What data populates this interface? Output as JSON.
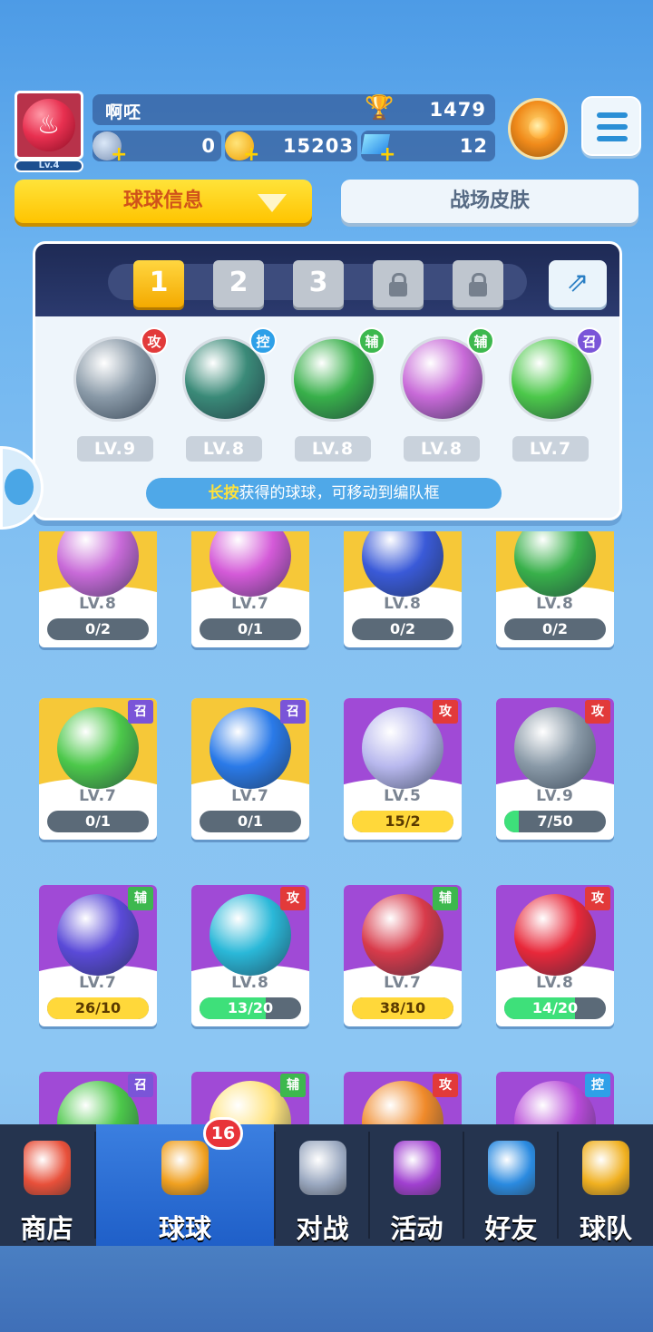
{
  "player": {
    "name": "啊呸",
    "level": "Lv.4",
    "trophies": "1479",
    "energy": "0",
    "coins": "15203",
    "gems": "12"
  },
  "tabs": {
    "ball_info": "球球信息",
    "skins": "战场皮肤"
  },
  "team": {
    "slots": [
      "1",
      "2",
      "3"
    ],
    "balls": [
      {
        "tag": "攻",
        "tag_type": "atk",
        "level": "LV.9",
        "color": "#8a9aa8"
      },
      {
        "tag": "控",
        "tag_type": "ctl",
        "level": "LV.8",
        "color": "#3a8a78"
      },
      {
        "tag": "辅",
        "tag_type": "sup",
        "level": "LV.8",
        "color": "#38b04a"
      },
      {
        "tag": "辅",
        "tag_type": "sup",
        "level": "LV.8",
        "color": "#c86ad8"
      },
      {
        "tag": "召",
        "tag_type": "sum",
        "level": "LV.7",
        "color": "#4cc84a"
      }
    ],
    "hint_highlight": "长按",
    "hint_rest": "获得的球球，可移动到编队框"
  },
  "cards": [
    {
      "bg": "yellow",
      "tag": "",
      "tag_type": "",
      "level": "LV.8",
      "progress": "0/2",
      "fill": 0,
      "fill_color": "#ffd83a",
      "color": "#c86ad8"
    },
    {
      "bg": "yellow",
      "tag": "",
      "tag_type": "",
      "level": "LV.7",
      "progress": "0/1",
      "fill": 0,
      "fill_color": "#ffd83a",
      "color": "#d45ad8"
    },
    {
      "bg": "yellow",
      "tag": "",
      "tag_type": "",
      "level": "LV.8",
      "progress": "0/2",
      "fill": 0,
      "fill_color": "#ffd83a",
      "color": "#3a5ad8"
    },
    {
      "bg": "yellow",
      "tag": "",
      "tag_type": "",
      "level": "LV.8",
      "progress": "0/2",
      "fill": 0,
      "fill_color": "#ffd83a",
      "color": "#38b04a"
    },
    {
      "bg": "yellow",
      "tag": "召",
      "tag_type": "sum",
      "level": "LV.7",
      "progress": "0/1",
      "fill": 0,
      "fill_color": "#ffd83a",
      "color": "#4cc84a"
    },
    {
      "bg": "yellow",
      "tag": "召",
      "tag_type": "sum",
      "level": "LV.7",
      "progress": "0/1",
      "fill": 0,
      "fill_color": "#ffd83a",
      "color": "#2a7ae8"
    },
    {
      "bg": "purple",
      "tag": "攻",
      "tag_type": "atk",
      "level": "LV.5",
      "progress": "15/2",
      "fill": 1,
      "fill_color": "#ffd83a",
      "color": "#b8b8ee"
    },
    {
      "bg": "purple",
      "tag": "攻",
      "tag_type": "atk",
      "level": "LV.9",
      "progress": "7/50",
      "fill": 0.14,
      "fill_color": "#3ee07a",
      "color": "#8a9aa8"
    },
    {
      "bg": "purple",
      "tag": "辅",
      "tag_type": "sup",
      "level": "LV.7",
      "progress": "26/10",
      "fill": 1,
      "fill_color": "#ffd83a",
      "color": "#5a4ad8"
    },
    {
      "bg": "purple",
      "tag": "攻",
      "tag_type": "atk",
      "level": "LV.8",
      "progress": "13/20",
      "fill": 0.65,
      "fill_color": "#3ee07a",
      "color": "#2ab8d8"
    },
    {
      "bg": "purple",
      "tag": "辅",
      "tag_type": "sup",
      "level": "LV.7",
      "progress": "38/10",
      "fill": 1,
      "fill_color": "#ffd83a",
      "color": "#d83a4a"
    },
    {
      "bg": "purple",
      "tag": "攻",
      "tag_type": "atk",
      "level": "LV.8",
      "progress": "14/20",
      "fill": 0.7,
      "fill_color": "#3ee07a",
      "color": "#e8283a"
    },
    {
      "bg": "purple",
      "tag": "召",
      "tag_type": "sum",
      "level": "",
      "progress": "",
      "fill": 0,
      "fill_color": "#ffd83a",
      "color": "#4cc84a"
    },
    {
      "bg": "purple",
      "tag": "辅",
      "tag_type": "sup",
      "level": "",
      "progress": "",
      "fill": 0,
      "fill_color": "#ffd83a",
      "color": "#ffe27a"
    },
    {
      "bg": "purple",
      "tag": "攻",
      "tag_type": "atk",
      "level": "",
      "progress": "",
      "fill": 0,
      "fill_color": "#ffd83a",
      "color": "#f08a2a"
    },
    {
      "bg": "purple",
      "tag": "控",
      "tag_type": "ctl",
      "level": "",
      "progress": "",
      "fill": 0,
      "fill_color": "#ffd83a",
      "color": "#b84ad8"
    }
  ],
  "nav": {
    "items": [
      {
        "label": "商店",
        "icon": "shop-icon",
        "color": "#e8503a"
      },
      {
        "label": "球球",
        "icon": "balls-icon",
        "color": "#f0a020"
      },
      {
        "label": "对战",
        "icon": "swords-icon",
        "color": "#9aa8c0"
      },
      {
        "label": "活动",
        "icon": "party-icon",
        "color": "#a040d0"
      },
      {
        "label": "好友",
        "icon": "friends-icon",
        "color": "#2a8ae0"
      },
      {
        "label": "球队",
        "icon": "whistle-icon",
        "color": "#f0b020"
      }
    ],
    "badge": "16"
  }
}
